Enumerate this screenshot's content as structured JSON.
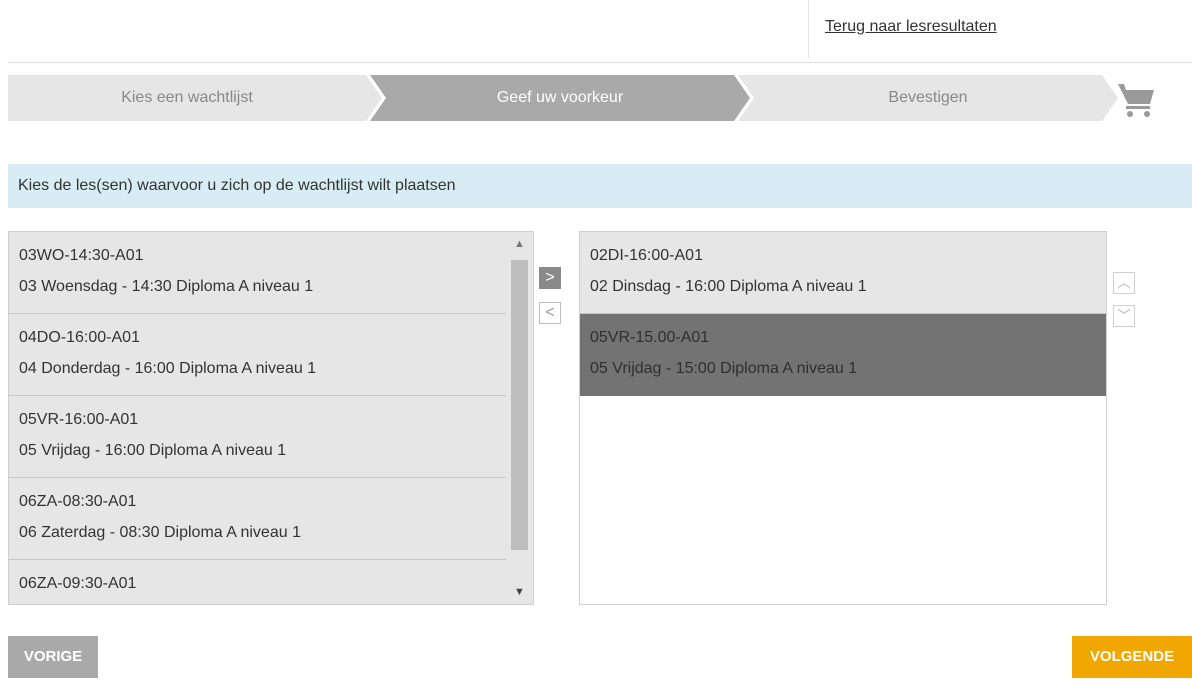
{
  "header": {
    "back_link": "Terug naar lesresultaten"
  },
  "steps": [
    {
      "label": "Kies een wachtlijst",
      "state": "done"
    },
    {
      "label": "Geef uw voorkeur",
      "state": "active"
    },
    {
      "label": "Bevestigen",
      "state": "todo"
    }
  ],
  "cart_icon": "shopping-cart-icon",
  "instruction": "Kies de les(sen) waarvoor u zich op de wachtlijst wilt plaatsen",
  "available": [
    {
      "code": "03WO-14:30-A01",
      "desc": "03 Woensdag - 14:30 Diploma A niveau 1"
    },
    {
      "code": "04DO-16:00-A01",
      "desc": "04 Donderdag - 16:00 Diploma A niveau 1"
    },
    {
      "code": "05VR-16:00-A01",
      "desc": "05 Vrijdag - 16:00 Diploma A niveau 1"
    },
    {
      "code": "06ZA-08:30-A01",
      "desc": "06 Zaterdag - 08:30 Diploma A niveau 1"
    },
    {
      "code": "06ZA-09:30-A01",
      "desc": ""
    }
  ],
  "selected": [
    {
      "code": "02DI-16:00-A01",
      "desc": "02 Dinsdag - 16:00 Diploma A niveau 1",
      "highlighted": false
    },
    {
      "code": "05VR-15.00-A01",
      "desc": "05 Vrijdag - 15:00 Diploma A niveau 1",
      "highlighted": true
    }
  ],
  "controls": {
    "move_right": ">",
    "move_left": "<",
    "scroll_up": "▲",
    "scroll_down": "▼",
    "order_up": "︿",
    "order_down": "﹀"
  },
  "buttons": {
    "prev": "VORIGE",
    "next": "VOLGENDE"
  },
  "colors": {
    "step_inactive": "#e6e6e6",
    "step_active": "#a9a9a9",
    "info_bg": "#d8ecf6",
    "selected_row": "#737373",
    "next_button": "#f0a800",
    "prev_button": "#a9a9a9"
  }
}
